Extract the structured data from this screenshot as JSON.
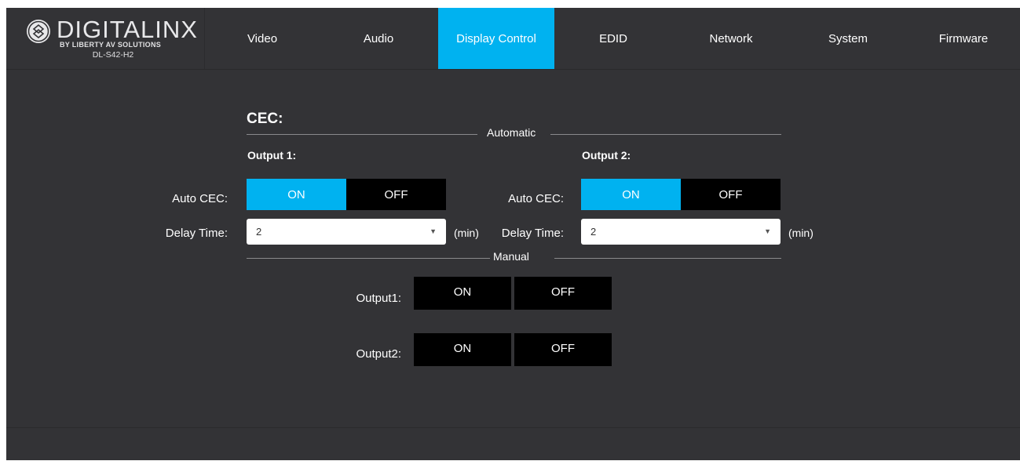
{
  "brand": {
    "name": "DIGITALINX",
    "sub": "BY LIBERTY AV SOLUTIONS",
    "model": "DL-S42-H2",
    "icon": "digitalinx-logo-icon"
  },
  "nav": {
    "items": [
      "Video",
      "Audio",
      "Display Control",
      "EDID",
      "Network",
      "System",
      "Firmware"
    ],
    "active": "Display Control"
  },
  "cec": {
    "title": "CEC:",
    "automatic_label": "Automatic",
    "manual_label": "Manual",
    "output1": {
      "heading": "Output 1:",
      "auto_cec_label": "Auto CEC:",
      "on_label": "ON",
      "off_label": "OFF",
      "delay_label": "Delay Time:",
      "delay_value": "2",
      "delay_unit": "(min)"
    },
    "output2": {
      "heading": "Output 2:",
      "auto_cec_label": "Auto CEC:",
      "on_label": "ON",
      "off_label": "OFF",
      "delay_label": "Delay Time:",
      "delay_value": "2",
      "delay_unit": "(min)"
    },
    "manual": {
      "output1_label": "Output1:",
      "output2_label": "Output2:",
      "on_label": "ON",
      "off_label": "OFF"
    }
  },
  "colors": {
    "accent": "#00b2f0",
    "background": "#333336",
    "button": "#000000"
  }
}
